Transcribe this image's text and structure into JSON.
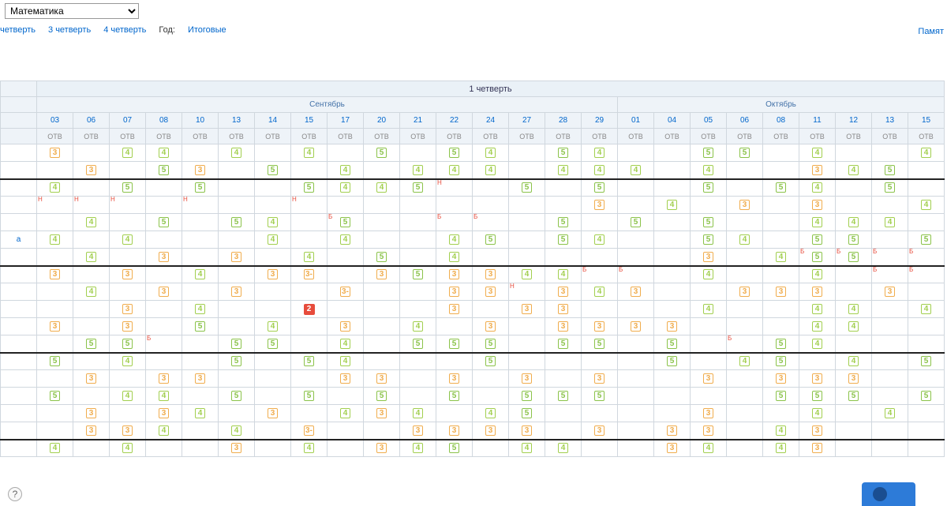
{
  "subject_selected": "Математика",
  "tabs": {
    "q2": "четверть",
    "q3": "3 четверть",
    "q4": "4 четверть",
    "year_label": "Год:",
    "final": "Итоговые"
  },
  "note_link": "Памят",
  "term_header": "1 четверть",
  "months": {
    "sep": "Сентябрь",
    "oct": "Октябрь"
  },
  "sep_days": [
    "03",
    "06",
    "07",
    "08",
    "10",
    "13",
    "14",
    "15",
    "17",
    "20",
    "21",
    "22",
    "24",
    "27",
    "28",
    "29"
  ],
  "oct_days": [
    "01",
    "04",
    "05",
    "06",
    "08",
    "11",
    "12",
    "13",
    "15"
  ],
  "sub": "ОТВ",
  "rows": [
    {
      "label": "",
      "hr": false,
      "cells": {
        "0": {
          "v": "3",
          "h": true
        },
        "2": {
          "v": "4",
          "h": true
        },
        "3": {
          "v": "4",
          "h": true
        },
        "5": {
          "v": "4",
          "h": true
        },
        "7": {
          "v": "4",
          "h": true
        },
        "9": {
          "v": "5",
          "h": true
        },
        "11": {
          "v": "5",
          "h": true
        },
        "12": {
          "v": "4",
          "h": true
        },
        "14": {
          "v": "5",
          "h": true
        },
        "15": {
          "v": "4",
          "h": true
        },
        "18": {
          "v": "5",
          "h": true
        },
        "19": {
          "v": "5",
          "h": true
        },
        "21": {
          "v": "4",
          "h": true
        },
        "24": {
          "v": "4",
          "h": true
        }
      }
    },
    {
      "label": "",
      "hr": false,
      "cells": {
        "1": {
          "v": "3",
          "h": true
        },
        "3": {
          "v": "5",
          "h": true
        },
        "4": {
          "v": "3",
          "h": true
        },
        "6": {
          "v": "5",
          "h": true
        },
        "8": {
          "v": "4",
          "h": true
        },
        "10": {
          "v": "4",
          "h": true
        },
        "11": {
          "v": "4",
          "h": true
        },
        "12": {
          "v": "4",
          "h": true
        },
        "14": {
          "v": "4",
          "h": true
        },
        "15": {
          "v": "4",
          "h": true
        },
        "16": {
          "v": "4",
          "h": true
        },
        "18": {
          "v": "4",
          "h": true
        },
        "21": {
          "v": "3",
          "h": true
        },
        "22": {
          "v": "4",
          "h": true
        },
        "23": {
          "v": "5",
          "h": true
        }
      }
    },
    {
      "label": "",
      "hr": true,
      "cells": {
        "0": {
          "v": "4",
          "h": true
        },
        "2": {
          "v": "5",
          "h": true
        },
        "4": {
          "v": "5",
          "h": true
        },
        "7": {
          "v": "5",
          "h": true
        },
        "8": {
          "v": "4",
          "h": true
        },
        "9": {
          "v": "4",
          "h": true
        },
        "10": {
          "v": "5",
          "h": true
        },
        "11": {
          "f": "Н",
          "fc": "red"
        },
        "13": {
          "v": "5",
          "h": true
        },
        "15": {
          "v": "5",
          "h": true
        },
        "18": {
          "v": "5",
          "h": true
        },
        "20": {
          "v": "5",
          "h": true
        },
        "21": {
          "v": "4",
          "h": true
        },
        "23": {
          "v": "5",
          "h": true
        }
      }
    },
    {
      "label": "",
      "hr": false,
      "cells": {
        "0": {
          "f": "Н",
          "fc": "red"
        },
        "1": {
          "f": "Н",
          "fc": "red"
        },
        "2": {
          "f": "Н",
          "fc": "red"
        },
        "4": {
          "f": "Н",
          "fc": "red"
        },
        "7": {
          "f": "Н",
          "fc": "red"
        },
        "15": {
          "v": "3",
          "h": true
        },
        "17": {
          "v": "4",
          "h": true
        },
        "19": {
          "v": "3",
          "h": true
        },
        "21": {
          "v": "3",
          "h": true
        },
        "24": {
          "v": "4",
          "h": true
        }
      }
    },
    {
      "label": "",
      "hr": false,
      "cells": {
        "1": {
          "v": "4",
          "h": true
        },
        "3": {
          "v": "5",
          "h": true
        },
        "5": {
          "v": "5",
          "h": true
        },
        "6": {
          "v": "4",
          "h": true
        },
        "8": {
          "v": "5",
          "h": true,
          "f": "Б",
          "fc": "red"
        },
        "11": {
          "f": "Б",
          "fc": "red"
        },
        "12": {
          "f": "Б",
          "fc": "red"
        },
        "14": {
          "v": "5",
          "h": true
        },
        "16": {
          "v": "5",
          "h": true
        },
        "18": {
          "v": "5",
          "h": true
        },
        "21": {
          "v": "4",
          "h": true
        },
        "22": {
          "v": "4",
          "h": true
        },
        "23": {
          "v": "4",
          "h": true
        }
      }
    },
    {
      "label": "а",
      "hr": false,
      "cells": {
        "0": {
          "v": "4",
          "h": true
        },
        "2": {
          "v": "4",
          "h": true
        },
        "6": {
          "v": "4",
          "h": true
        },
        "8": {
          "v": "4",
          "h": true
        },
        "11": {
          "v": "4",
          "h": true
        },
        "12": {
          "v": "5",
          "h": true
        },
        "14": {
          "v": "5",
          "h": true
        },
        "15": {
          "v": "4",
          "h": true
        },
        "18": {
          "v": "5",
          "h": true
        },
        "19": {
          "v": "4",
          "h": true
        },
        "21": {
          "v": "5",
          "h": true
        },
        "22": {
          "v": "5",
          "h": true
        },
        "24": {
          "v": "5",
          "h": true
        }
      }
    },
    {
      "label": "",
      "hr": false,
      "cells": {
        "1": {
          "v": "4",
          "h": true
        },
        "3": {
          "v": "3",
          "h": true
        },
        "5": {
          "v": "3",
          "h": true
        },
        "7": {
          "v": "4",
          "h": true
        },
        "9": {
          "v": "5",
          "h": true
        },
        "11": {
          "v": "4",
          "h": true
        },
        "18": {
          "v": "3",
          "h": true
        },
        "20": {
          "v": "4",
          "h": true
        },
        "21": {
          "f": "Б",
          "fc": "red",
          "v": "5",
          "h": true
        },
        "22": {
          "f": "Б",
          "fc": "red",
          "v": "5",
          "h": true
        },
        "23": {
          "f": "Б",
          "fc": "red"
        },
        "24": {
          "f": "Б",
          "fc": "red"
        }
      }
    },
    {
      "label": "",
      "hr": true,
      "cells": {
        "0": {
          "v": "3",
          "h": true
        },
        "2": {
          "v": "3",
          "h": true
        },
        "4": {
          "v": "4",
          "h": true
        },
        "6": {
          "v": "3",
          "h": true
        },
        "7": {
          "v": "3-",
          "h": true
        },
        "9": {
          "v": "3",
          "h": true
        },
        "10": {
          "v": "5",
          "h": true
        },
        "11": {
          "v": "3",
          "h": true
        },
        "12": {
          "v": "3",
          "h": true
        },
        "13": {
          "v": "4",
          "h": true
        },
        "14": {
          "v": "4",
          "h": true
        },
        "15": {
          "f": "Б",
          "fc": "red"
        },
        "16": {
          "f": "Б",
          "fc": "red"
        },
        "18": {
          "v": "4",
          "h": true
        },
        "21": {
          "v": "4",
          "h": true
        },
        "23": {
          "f": "Б",
          "fc": "red"
        },
        "24": {
          "f": "Б",
          "fc": "red"
        }
      }
    },
    {
      "label": "",
      "hr": false,
      "cells": {
        "1": {
          "v": "4",
          "h": true
        },
        "3": {
          "v": "3",
          "h": true
        },
        "5": {
          "v": "3",
          "h": true
        },
        "8": {
          "v": "3-",
          "h": true
        },
        "11": {
          "v": "3",
          "h": true
        },
        "12": {
          "v": "3",
          "h": true
        },
        "13": {
          "f": "Н",
          "fc": "red"
        },
        "14": {
          "v": "3",
          "h": true
        },
        "15": {
          "v": "4",
          "h": true
        },
        "16": {
          "v": "3",
          "h": true
        },
        "19": {
          "v": "3",
          "h": true
        },
        "20": {
          "v": "3",
          "h": true
        },
        "21": {
          "v": "3",
          "h": true
        },
        "23": {
          "v": "3",
          "h": true
        }
      }
    },
    {
      "label": "",
      "hr": false,
      "cells": {
        "2": {
          "v": "3",
          "h": true
        },
        "4": {
          "v": "4",
          "h": true
        },
        "7": {
          "v": "2",
          "s": true
        },
        "11": {
          "v": "3",
          "h": true
        },
        "13": {
          "v": "3",
          "h": true
        },
        "14": {
          "v": "3",
          "h": true
        },
        "18": {
          "v": "4",
          "h": true
        },
        "21": {
          "v": "4",
          "h": true
        },
        "22": {
          "v": "4",
          "h": true
        },
        "24": {
          "v": "4",
          "h": true
        }
      }
    },
    {
      "label": "",
      "hr": false,
      "cells": {
        "0": {
          "v": "3",
          "h": true
        },
        "2": {
          "v": "3",
          "h": true
        },
        "4": {
          "v": "5",
          "h": true
        },
        "6": {
          "v": "4",
          "h": true
        },
        "8": {
          "v": "3",
          "h": true
        },
        "10": {
          "v": "4",
          "h": true
        },
        "12": {
          "v": "3",
          "h": true
        },
        "14": {
          "v": "3",
          "h": true
        },
        "15": {
          "v": "3",
          "h": true
        },
        "16": {
          "v": "3",
          "h": true
        },
        "17": {
          "v": "3",
          "h": true
        },
        "21": {
          "v": "4",
          "h": true
        },
        "22": {
          "v": "4",
          "h": true
        }
      }
    },
    {
      "label": "",
      "hr": false,
      "cells": {
        "1": {
          "v": "5",
          "h": true
        },
        "2": {
          "v": "5",
          "h": true
        },
        "3": {
          "f": "Б",
          "fc": "red"
        },
        "5": {
          "v": "5",
          "h": true
        },
        "6": {
          "v": "5",
          "h": true
        },
        "8": {
          "v": "4",
          "h": true
        },
        "10": {
          "v": "5",
          "h": true
        },
        "11": {
          "v": "5",
          "h": true
        },
        "12": {
          "v": "5",
          "h": true
        },
        "14": {
          "v": "5",
          "h": true
        },
        "15": {
          "v": "5",
          "h": true
        },
        "17": {
          "v": "5",
          "h": true
        },
        "19": {
          "f": "Б",
          "fc": "red"
        },
        "20": {
          "v": "5",
          "h": true
        },
        "21": {
          "v": "4",
          "h": true
        }
      }
    },
    {
      "label": "",
      "hr": true,
      "cells": {
        "0": {
          "v": "5",
          "h": true
        },
        "2": {
          "v": "4",
          "h": true
        },
        "5": {
          "v": "5",
          "h": true
        },
        "7": {
          "v": "5",
          "h": true
        },
        "8": {
          "v": "4",
          "h": true
        },
        "12": {
          "v": "5",
          "h": true
        },
        "17": {
          "v": "5",
          "h": true
        },
        "19": {
          "v": "4",
          "h": true
        },
        "20": {
          "v": "5",
          "h": true
        },
        "22": {
          "v": "4",
          "h": true
        },
        "24": {
          "v": "5",
          "h": true
        }
      }
    },
    {
      "label": "",
      "hr": false,
      "cells": {
        "1": {
          "v": "3",
          "h": true
        },
        "3": {
          "v": "3",
          "h": true
        },
        "4": {
          "v": "3",
          "h": true
        },
        "8": {
          "v": "3",
          "h": true
        },
        "9": {
          "v": "3",
          "h": true
        },
        "11": {
          "v": "3",
          "h": true
        },
        "13": {
          "v": "3",
          "h": true
        },
        "15": {
          "v": "3",
          "h": true
        },
        "18": {
          "v": "3",
          "h": true
        },
        "20": {
          "v": "3",
          "h": true
        },
        "21": {
          "v": "3",
          "h": true
        },
        "22": {
          "v": "3",
          "h": true
        }
      }
    },
    {
      "label": "",
      "hr": false,
      "cells": {
        "0": {
          "v": "5",
          "h": true
        },
        "2": {
          "v": "4",
          "h": true
        },
        "3": {
          "v": "4",
          "h": true
        },
        "5": {
          "v": "5",
          "h": true
        },
        "7": {
          "v": "5",
          "h": true
        },
        "9": {
          "v": "5",
          "h": true
        },
        "11": {
          "v": "5",
          "h": true
        },
        "13": {
          "v": "5",
          "h": true
        },
        "14": {
          "v": "5",
          "h": true
        },
        "15": {
          "v": "5",
          "h": true
        },
        "20": {
          "v": "5",
          "h": true
        },
        "21": {
          "v": "5",
          "h": true
        },
        "22": {
          "v": "5",
          "h": true
        },
        "24": {
          "v": "5",
          "h": true
        }
      }
    },
    {
      "label": "",
      "hr": false,
      "cells": {
        "1": {
          "v": "3",
          "h": true
        },
        "3": {
          "v": "3",
          "h": true
        },
        "4": {
          "v": "4",
          "h": true
        },
        "6": {
          "v": "3",
          "h": true
        },
        "8": {
          "v": "4",
          "h": true
        },
        "9": {
          "v": "3",
          "h": true
        },
        "10": {
          "v": "4",
          "h": true
        },
        "12": {
          "v": "4",
          "h": true
        },
        "13": {
          "v": "5",
          "h": true
        },
        "18": {
          "v": "3",
          "h": true
        },
        "21": {
          "v": "4",
          "h": true
        },
        "23": {
          "v": "4",
          "h": true
        }
      }
    },
    {
      "label": "",
      "hr": false,
      "cells": {
        "1": {
          "v": "3",
          "h": true
        },
        "2": {
          "v": "3",
          "h": true
        },
        "3": {
          "v": "4",
          "h": true
        },
        "5": {
          "v": "4",
          "h": true
        },
        "7": {
          "v": "3-",
          "h": true
        },
        "10": {
          "v": "3",
          "h": true
        },
        "11": {
          "v": "3",
          "h": true
        },
        "12": {
          "v": "3",
          "h": true
        },
        "13": {
          "v": "3",
          "h": true
        },
        "15": {
          "v": "3",
          "h": true
        },
        "17": {
          "v": "3",
          "h": true
        },
        "18": {
          "v": "3",
          "h": true
        },
        "20": {
          "v": "4",
          "h": true
        },
        "21": {
          "v": "3",
          "h": true
        }
      }
    },
    {
      "label": "",
      "hr": true,
      "cells": {
        "0": {
          "v": "4",
          "h": true
        },
        "2": {
          "v": "4",
          "h": true
        },
        "5": {
          "v": "3",
          "h": true
        },
        "7": {
          "v": "4",
          "h": true
        },
        "9": {
          "v": "3",
          "h": true
        },
        "10": {
          "v": "4",
          "h": true
        },
        "11": {
          "v": "5",
          "h": true
        },
        "13": {
          "v": "4",
          "h": true
        },
        "14": {
          "v": "4",
          "h": true
        },
        "17": {
          "v": "3",
          "h": true
        },
        "18": {
          "v": "4",
          "h": true
        },
        "20": {
          "v": "4",
          "h": true
        },
        "21": {
          "v": "3",
          "h": true
        }
      }
    }
  ],
  "help_label": "?",
  "chat_label": ""
}
